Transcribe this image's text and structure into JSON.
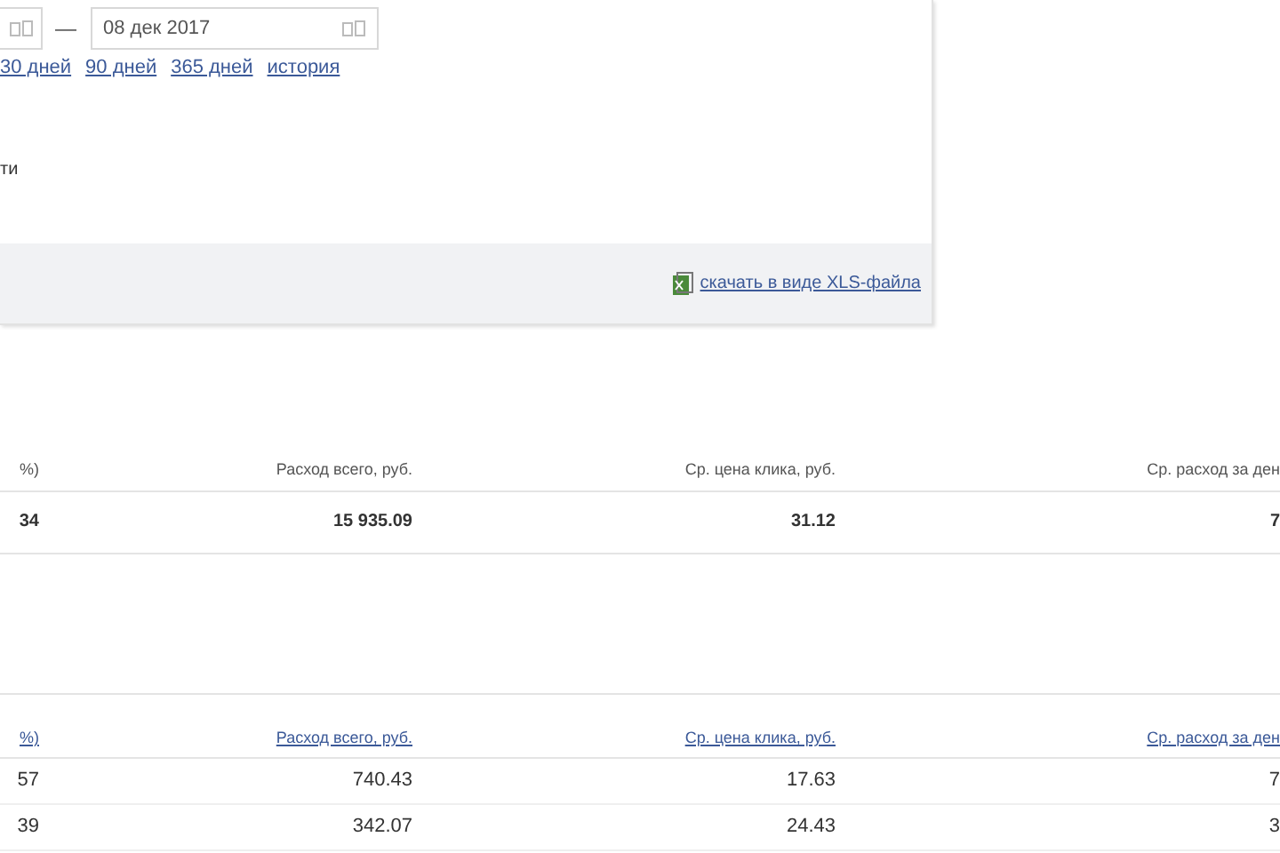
{
  "period": {
    "date_to": "08 дек 2017",
    "separator": "—",
    "presets": [
      "30 дней",
      "90 дней",
      "365 дней",
      "история"
    ]
  },
  "option_label": "ти",
  "download_link": "скачать в виде XLS-файла",
  "summary_table": {
    "columns": [
      "%)",
      "Расход всего, руб.",
      "Ср. цена клика, руб.",
      "Ср. расход за ден"
    ],
    "rows": [
      [
        "34",
        "15 935.09",
        "31.12",
        "7"
      ]
    ]
  },
  "detail_table": {
    "columns": [
      "%)",
      "Расход всего, руб.",
      "Ср. цена клика, руб.",
      "Ср. расход за ден"
    ],
    "rows": [
      [
        "57",
        "740.43",
        "17.63",
        "7"
      ],
      [
        "39",
        "342.07",
        "24.43",
        "3"
      ]
    ]
  }
}
